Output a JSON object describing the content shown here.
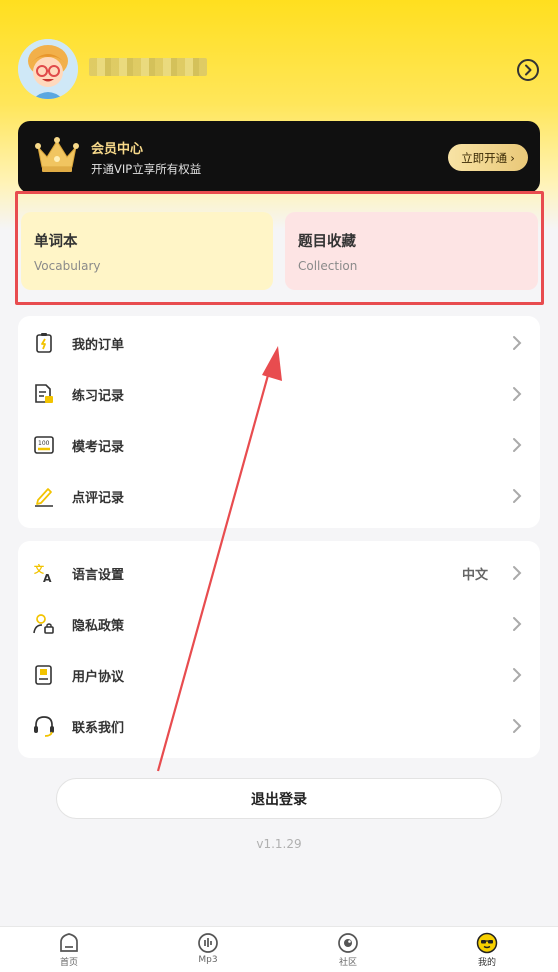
{
  "profile": {
    "username": "",
    "avatar_icon": "cartoon-avatar",
    "arrow_icon": "circle-chevron-right-icon"
  },
  "vip": {
    "title": "会员中心",
    "subtitle": "开通VIP立享所有权益",
    "button_label": "立即开通",
    "button_arrow": "›"
  },
  "favorites": [
    {
      "title": "单词本",
      "subtitle": "Vocabulary"
    },
    {
      "title": "题目收藏",
      "subtitle": "Collection"
    }
  ],
  "menu_records": [
    {
      "label": "我的订单",
      "icon": "order-icon"
    },
    {
      "label": "练习记录",
      "icon": "practice-record-icon"
    },
    {
      "label": "模考记录",
      "icon": "mock-exam-icon"
    },
    {
      "label": "点评记录",
      "icon": "review-pen-icon"
    }
  ],
  "menu_settings": [
    {
      "label": "语言设置",
      "value": "中文",
      "icon": "translate-icon"
    },
    {
      "label": "隐私政策",
      "value": "",
      "icon": "privacy-user-lock-icon"
    },
    {
      "label": "用户协议",
      "value": "",
      "icon": "agreement-icon"
    },
    {
      "label": "联系我们",
      "value": "",
      "icon": "headset-icon"
    }
  ],
  "logout_label": "退出登录",
  "version": "v1.1.29",
  "tabs": [
    {
      "label": "首页",
      "icon": "home-icon",
      "active": false
    },
    {
      "label": "Mp3",
      "icon": "audio-icon",
      "active": false
    },
    {
      "label": "社区",
      "icon": "community-icon",
      "active": false
    },
    {
      "label": "我的",
      "icon": "mine-face-icon",
      "active": true
    }
  ],
  "colors": {
    "header_yellow": "#ffdf1f",
    "highlight_red": "#e84c4f",
    "vocab_bg": "#fff5c7",
    "collection_bg": "#fde4e4",
    "vip_gold": "#f7d98a"
  }
}
